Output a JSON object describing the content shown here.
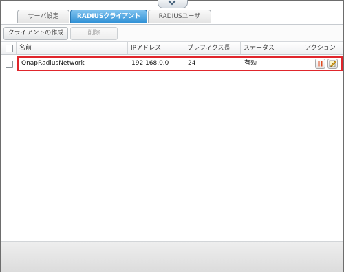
{
  "tabs": [
    {
      "label": "サーバ設定"
    },
    {
      "label": "RADIUSクライアント"
    },
    {
      "label": "RADIUSユーザ"
    }
  ],
  "toolbar": {
    "create_label": "クライアントの作成",
    "delete_label": "削除"
  },
  "table": {
    "columns": [
      "名前",
      "IPアドレス",
      "プレフィクス長",
      "ステータス",
      "アクション"
    ],
    "rows": [
      {
        "name": "QnapRadiusNetwork",
        "ip": "192.168.0.0",
        "prefix": "24",
        "status": "有効"
      }
    ]
  },
  "icons": {
    "collapse": "chevron-down-icon",
    "pause": "pause-icon",
    "edit": "edit-icon"
  },
  "colors": {
    "active_tab": "#2d8fd5",
    "selection_border": "#e0262c",
    "pause_icon": "#e04a1f"
  }
}
